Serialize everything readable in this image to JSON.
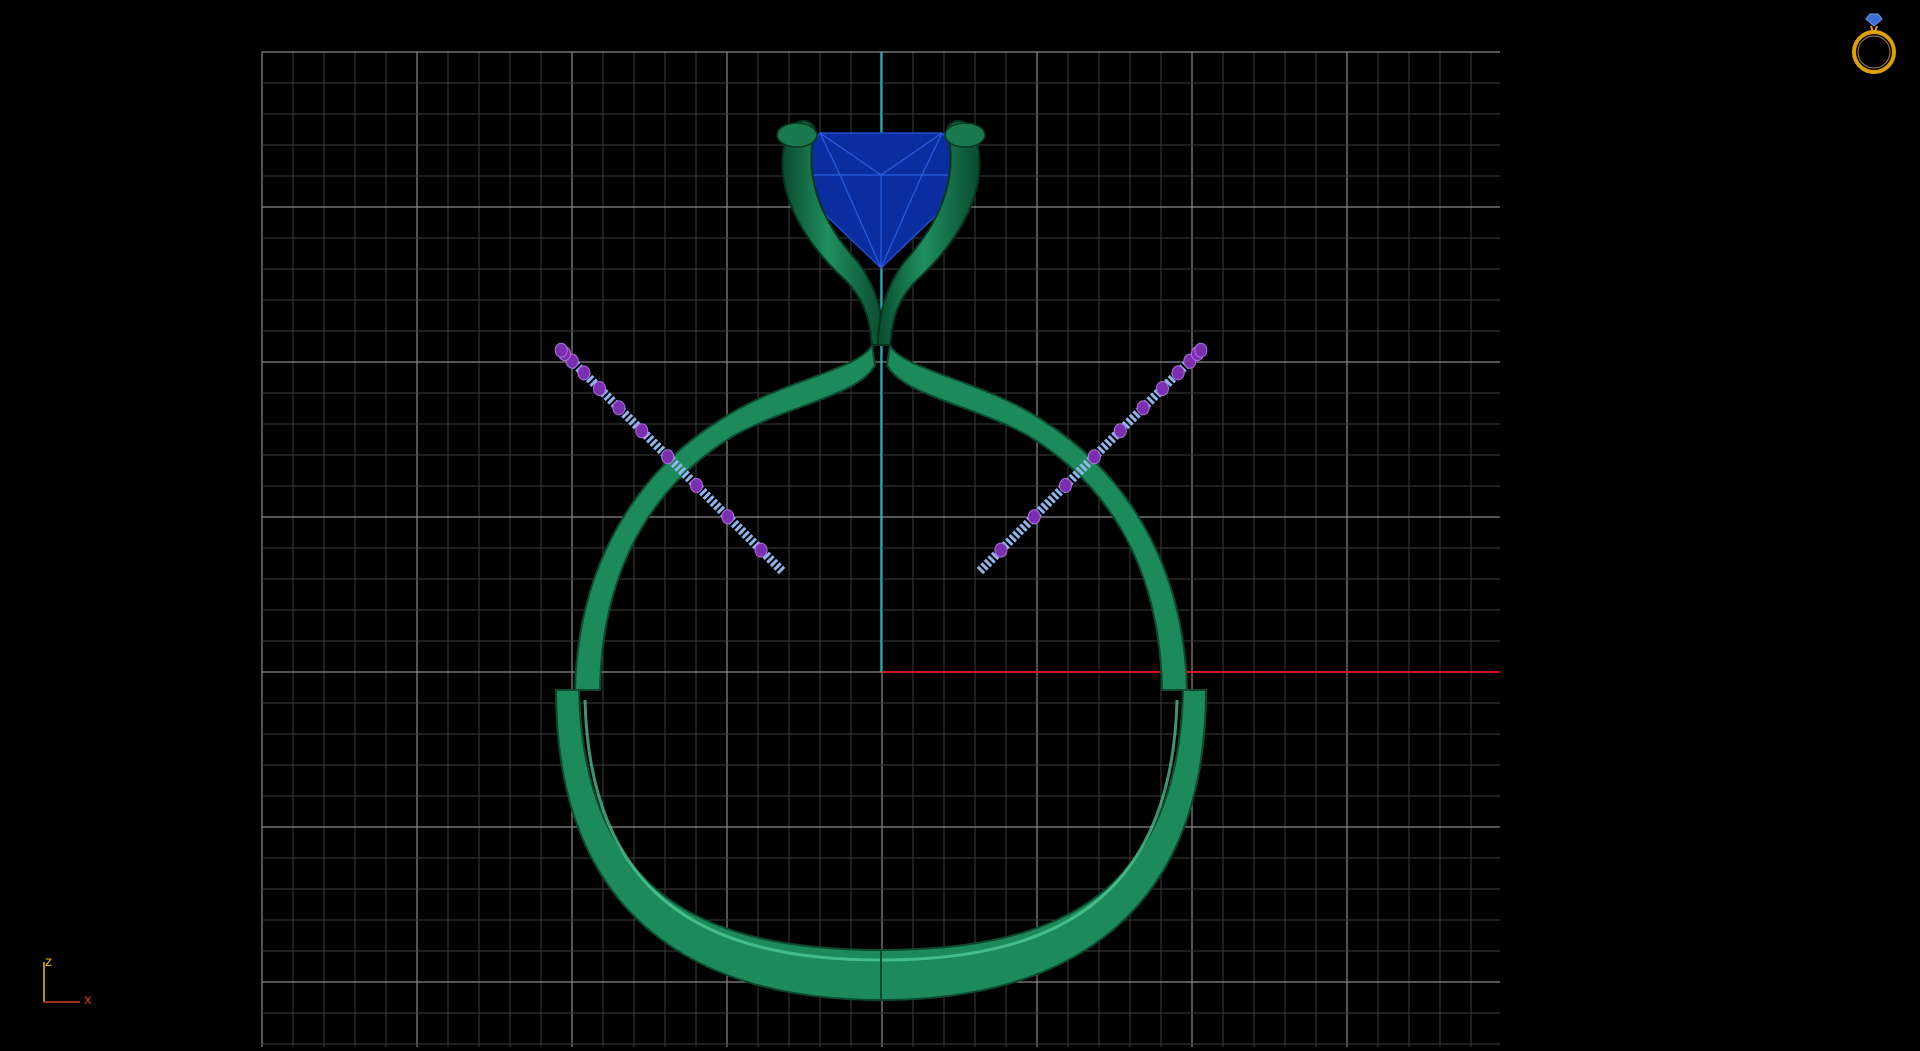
{
  "viewport": {
    "view": "front",
    "background_color": "#000000",
    "grid": {
      "visible": true,
      "major_color": "#8a8a8a",
      "minor_color": "#3c3c3c"
    },
    "vertical_axis_color": "#00b8c4",
    "horizontal_axis_color": "#d01818"
  },
  "model": {
    "type": "solitaire ring with pave band",
    "metal_color": "#1f8f5e",
    "center_stone_color": "#0a2ea0",
    "side_stone_color": "#8fb6ec",
    "bead_color": "#7a2fb0"
  },
  "nav_widget": {
    "icon": "ring-icon",
    "metal_color": "#e0a000",
    "stone_color": "#3a6fd8"
  },
  "axis_indicator": {
    "z_label": "z",
    "x_label": "x",
    "z_color": "#e8c200",
    "x_color": "#d23b2a"
  }
}
